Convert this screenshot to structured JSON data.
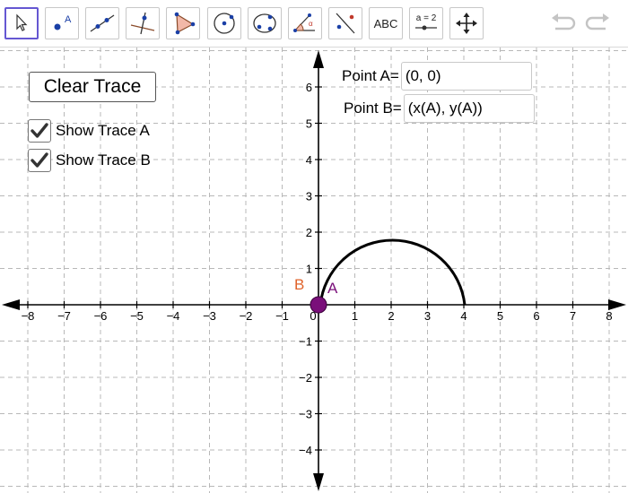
{
  "toolbar": {
    "tools": [
      {
        "name": "move-tool-icon",
        "active": true
      },
      {
        "name": "point-tool-icon"
      },
      {
        "name": "line-tool-icon"
      },
      {
        "name": "perpendicular-line-tool-icon"
      },
      {
        "name": "polygon-tool-icon"
      },
      {
        "name": "circle-center-point-tool-icon"
      },
      {
        "name": "circle-three-points-tool-icon"
      },
      {
        "name": "angle-tool-icon"
      },
      {
        "name": "reflect-tool-icon"
      },
      {
        "name": "text-tool-icon",
        "label": "ABC"
      },
      {
        "name": "slider-tool-icon",
        "label": "a = 2"
      },
      {
        "name": "move-graphics-view-tool-icon"
      }
    ],
    "undo_icon": "undo-icon",
    "redo_icon": "redo-icon"
  },
  "controls": {
    "clear_trace_label": "Clear Trace",
    "show_trace_a_label": "Show Trace A",
    "show_trace_a_checked": true,
    "show_trace_b_label": "Show Trace B",
    "show_trace_b_checked": true
  },
  "inputs": {
    "point_a_label": "Point A=",
    "point_a_value": "(0, 0)",
    "point_b_label": "Point B=",
    "point_b_value": "(x(A), y(A))"
  },
  "graph": {
    "x_ticks": [
      "−8",
      "−7",
      "−6",
      "−5",
      "−4",
      "−3",
      "−2",
      "−1",
      "0",
      "1",
      "2",
      "3",
      "4",
      "5",
      "6",
      "7",
      "8"
    ],
    "y_ticks_pos": [
      "1",
      "2",
      "3",
      "4",
      "5",
      "6"
    ],
    "y_ticks_neg": [
      "−1",
      "−2",
      "−3",
      "−4"
    ],
    "point_a_label": "A",
    "point_b_label": "B",
    "point_a_color": "#7a0f7a",
    "point_b_color": "#e0632b",
    "arc_color": "#000000",
    "grid_color": "#b8b8b8"
  }
}
